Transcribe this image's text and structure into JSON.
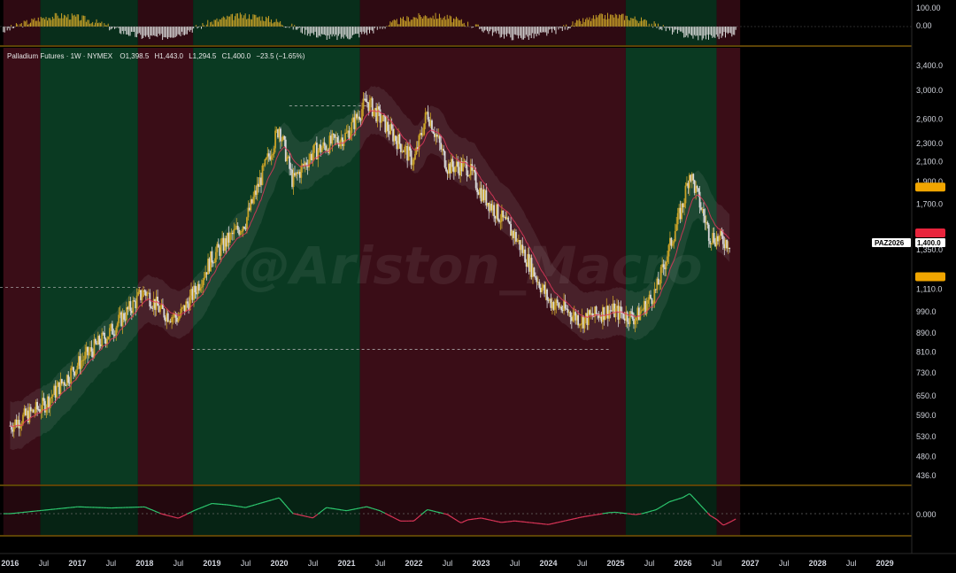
{
  "header": {
    "symbol": "Palladium Futures · 1W · NYMEX",
    "open": "O1,398.5",
    "high": "H1,443.0",
    "low": "L1,294.5",
    "close": "C1,400.0",
    "change": "−23.5 (−1.65%)"
  },
  "watermark": "@Ariston_Macro",
  "ticker_label": "PAZ2026",
  "colors": {
    "bull_band": "#0a3a22",
    "bear_band": "#3a0d17",
    "up_candle": "#c9a227",
    "down_candle": "#d9d9d9",
    "ema_line": "#e0365a",
    "trend_line": "#2ecc71",
    "orange_border": "#b8860b",
    "price_marker_red": "#e8243c",
    "price_marker_orange": "#f0a500"
  },
  "chart_data": [
    {
      "type": "bar",
      "panel": "top-oscillator",
      "y_ticks": [
        "100.00",
        "0.00"
      ],
      "ylim": [
        -100,
        100
      ]
    },
    {
      "type": "line",
      "panel": "price",
      "title": "Palladium Futures · 1W · NYMEX",
      "scale": "log",
      "y_ticks": [
        "3,400.0",
        "3,000.0",
        "2,600.0",
        "2,300.0",
        "2,100.0",
        "1,900.0",
        "1,700.0",
        "1,350.0",
        "1,110.0",
        "990.0",
        "890.0",
        "810.0",
        "730.0",
        "650.0",
        "590.0",
        "530.0",
        "480.0",
        "436.0"
      ],
      "ylim": [
        436,
        3400
      ],
      "x": [
        2016.0,
        2016.5,
        2017.0,
        2017.5,
        2018.0,
        2018.25,
        2018.5,
        2018.75,
        2019.0,
        2019.5,
        2020.0,
        2020.2,
        2020.5,
        2021.0,
        2021.3,
        2021.6,
        2022.0,
        2022.2,
        2022.5,
        2022.8,
        2023.0,
        2023.5,
        2024.0,
        2024.5,
        2024.9,
        2025.3,
        2025.6,
        2026.0,
        2026.1,
        2026.4,
        2026.7
      ],
      "close": [
        560,
        620,
        760,
        900,
        1100,
        990,
        960,
        1100,
        1300,
        1560,
        2500,
        1900,
        2200,
        2400,
        2850,
        2500,
        2100,
        2700,
        2050,
        2050,
        1800,
        1450,
        1050,
        950,
        1000,
        960,
        1100,
        1700,
        2000,
        1450,
        1400
      ],
      "band_colors": [
        "bear",
        "bull",
        "bear",
        "bull",
        "bear",
        "bull",
        "bear"
      ],
      "band_ranges": [
        [
          2015.9,
          2016.45
        ],
        [
          2016.45,
          2017.9
        ],
        [
          2017.9,
          2018.72
        ],
        [
          2018.72,
          2021.2
        ],
        [
          2021.2,
          2025.15
        ],
        [
          2025.15,
          2026.5
        ],
        [
          2026.5,
          2026.85
        ]
      ],
      "last_price": "1,400.0"
    },
    {
      "type": "line",
      "panel": "bottom-oscillator",
      "y_ticks": [
        "0.000"
      ],
      "ylim": [
        -1,
        1
      ]
    }
  ],
  "x_axis": {
    "labels": [
      "2016",
      "Jul",
      "2017",
      "Jul",
      "2018",
      "Jul",
      "2019",
      "Jul",
      "2020",
      "Jul",
      "2021",
      "Jul",
      "2022",
      "Jul",
      "2023",
      "Jul",
      "2024",
      "Jul",
      "2025",
      "Jul",
      "2026",
      "Jul",
      "2027",
      "Jul",
      "2028",
      "Jul",
      "2029"
    ]
  }
}
